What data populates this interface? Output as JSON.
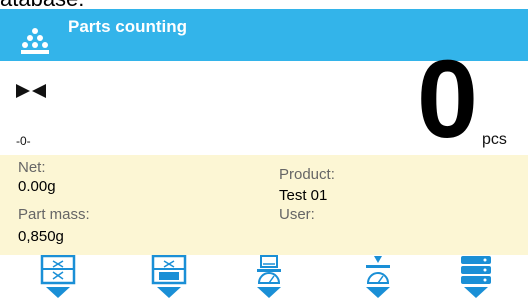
{
  "header": {
    "partial_top_text": "atabase:",
    "title": "Parts counting",
    "title_icon": "parts-counting-icon"
  },
  "display": {
    "stability_icon": "stable-indicator-icon",
    "zero_indicator": "-0-",
    "value": "0",
    "unit": "pcs"
  },
  "info": {
    "net_label": "Net:",
    "net_value": "0.00g",
    "part_mass_label": "Part mass:",
    "part_mass_value": "0,850g",
    "product_label": "Product:",
    "product_value": "Test 01",
    "user_label": "User:",
    "user_value": ""
  },
  "toolbar": {
    "buttons": [
      {
        "icon": "set-reference-mass-icon"
      },
      {
        "icon": "set-part-mass-icon"
      },
      {
        "icon": "weigh-sample-icon"
      },
      {
        "icon": "tare-sample-icon"
      },
      {
        "icon": "database-icon"
      }
    ]
  },
  "colors": {
    "titlebar": "#33b4ea",
    "info_panel": "#fcf6d4",
    "icon_blue": "#1a8fd6"
  }
}
